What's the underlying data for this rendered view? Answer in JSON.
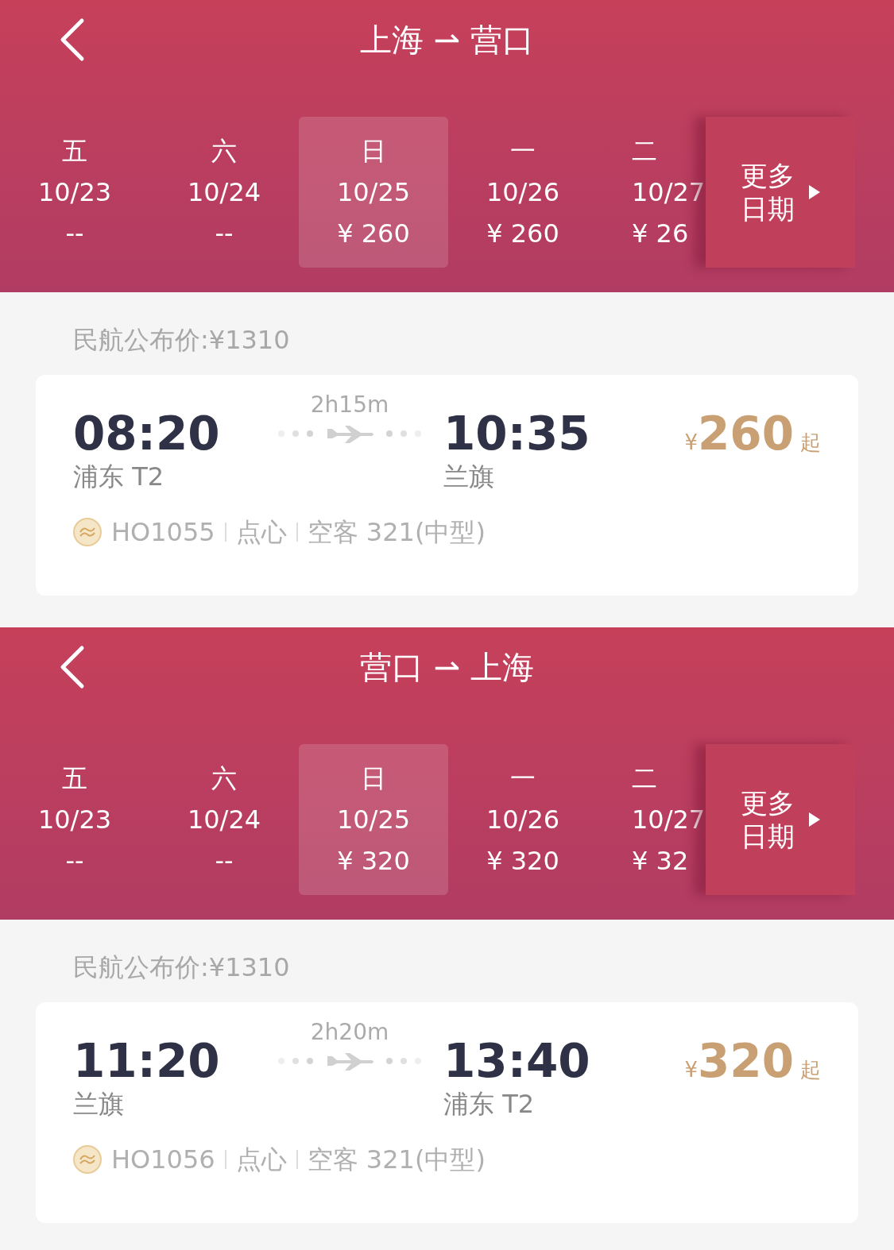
{
  "sections": [
    {
      "title": "上海 ⇀ 营口",
      "dates": [
        {
          "weekday": "五",
          "date": "10/23",
          "price": "--",
          "selected": false
        },
        {
          "weekday": "六",
          "date": "10/24",
          "price": "--",
          "selected": false
        },
        {
          "weekday": "日",
          "date": "10/25",
          "price": "¥ 260",
          "selected": true
        },
        {
          "weekday": "一",
          "date": "10/26",
          "price": "¥ 260",
          "selected": false
        },
        {
          "weekday": "二",
          "date": "10/27",
          "price": "¥ 26",
          "selected": false
        }
      ],
      "more_dates": "更多日期",
      "published_price": "民航公布价:¥1310",
      "flight": {
        "depart_time": "08:20",
        "depart_airport": "浦东 T2",
        "duration": "2h15m",
        "arrive_time": "10:35",
        "arrive_airport": "兰旗",
        "currency": "¥",
        "price": "260",
        "price_suffix": "起",
        "flight_no": "HO1055",
        "meal": "点心",
        "aircraft": "空客 321(中型)"
      }
    },
    {
      "title": "营口 ⇀ 上海",
      "dates": [
        {
          "weekday": "五",
          "date": "10/23",
          "price": "--",
          "selected": false
        },
        {
          "weekday": "六",
          "date": "10/24",
          "price": "--",
          "selected": false
        },
        {
          "weekday": "日",
          "date": "10/25",
          "price": "¥ 320",
          "selected": true
        },
        {
          "weekday": "一",
          "date": "10/26",
          "price": "¥ 320",
          "selected": false
        },
        {
          "weekday": "二",
          "date": "10/27",
          "price": "¥ 32",
          "selected": false
        }
      ],
      "more_dates": "更多日期",
      "published_price": "民航公布价:¥1310",
      "flight": {
        "depart_time": "11:20",
        "depart_airport": "兰旗",
        "duration": "2h20m",
        "arrive_time": "13:40",
        "arrive_airport": "浦东 T2",
        "currency": "¥",
        "price": "320",
        "price_suffix": "起",
        "flight_no": "HO1056",
        "meal": "点心",
        "aircraft": "空客 321(中型)"
      }
    }
  ]
}
